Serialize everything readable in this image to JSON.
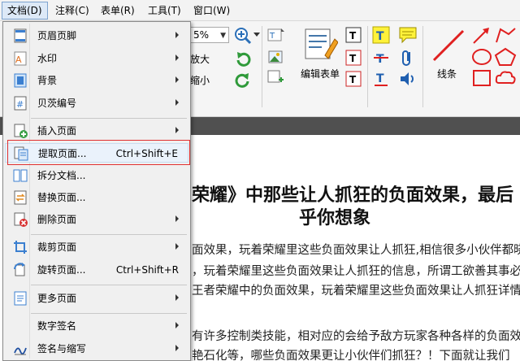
{
  "menubar": {
    "items": [
      {
        "label": "文档(D)"
      },
      {
        "label": "注释(C)"
      },
      {
        "label": "表单(R)"
      },
      {
        "label": "工具(T)"
      },
      {
        "label": "窗口(W)"
      }
    ]
  },
  "toolbar": {
    "zoom_value": "5%",
    "fit_width_label": "放大",
    "shrink_label": "缩小",
    "edit_form_label": "编辑表单",
    "lines_label": "线条"
  },
  "menu": {
    "items": [
      {
        "label": "页眉页脚",
        "shortcut": "",
        "icon": "header-footer-icon"
      },
      {
        "label": "水印",
        "shortcut": "",
        "icon": "watermark-icon"
      },
      {
        "label": "背景",
        "shortcut": "",
        "icon": "background-icon"
      },
      {
        "label": "贝茨编号",
        "shortcut": "",
        "icon": "bates-number-icon"
      },
      {
        "label": "插入页面",
        "shortcut": "",
        "icon": "insert-page-icon"
      },
      {
        "label": "提取页面...",
        "shortcut": "Ctrl+Shift+E",
        "icon": "extract-page-icon"
      },
      {
        "label": "拆分文档...",
        "shortcut": "",
        "icon": "split-document-icon"
      },
      {
        "label": "替换页面...",
        "shortcut": "",
        "icon": "replace-page-icon"
      },
      {
        "label": "删除页面",
        "shortcut": "",
        "icon": "delete-page-icon"
      },
      {
        "label": "裁剪页面",
        "shortcut": "",
        "icon": "crop-page-icon"
      },
      {
        "label": "旋转页面...",
        "shortcut": "Ctrl+Shift+R",
        "icon": "rotate-page-icon"
      },
      {
        "label": "更多页面",
        "shortcut": "",
        "icon": "more-pages-icon"
      },
      {
        "label": "数字签名",
        "shortcut": "",
        "icon": "digital-signature-icon"
      },
      {
        "label": "签名与缩写",
        "shortcut": "",
        "icon": "sign-initials-icon"
      }
    ]
  },
  "document": {
    "title_line1": "荣耀》中那些让人抓狂的负面效果，最后",
    "title_line2": "乎你想象",
    "para1_line1": "面效果，玩着荣耀里这些负面效果让人抓狂,相信很多小伙伴都晓",
    "para1_line2": "，玩着荣耀里这些负面效果让人抓狂的信息，所谓工欲善其事必先",
    "para1_line3": "王者荣耀中的负面效果，玩着荣耀里这些负面效果让人抓狂详情",
    "para2_line1": "有许多控制类技能，相对应的会给予敌方玩家各种各样的负面效果",
    "para2_line2": "艳石化等，哪些负面效果更让小伙伴们抓狂？！下面就让我们"
  }
}
